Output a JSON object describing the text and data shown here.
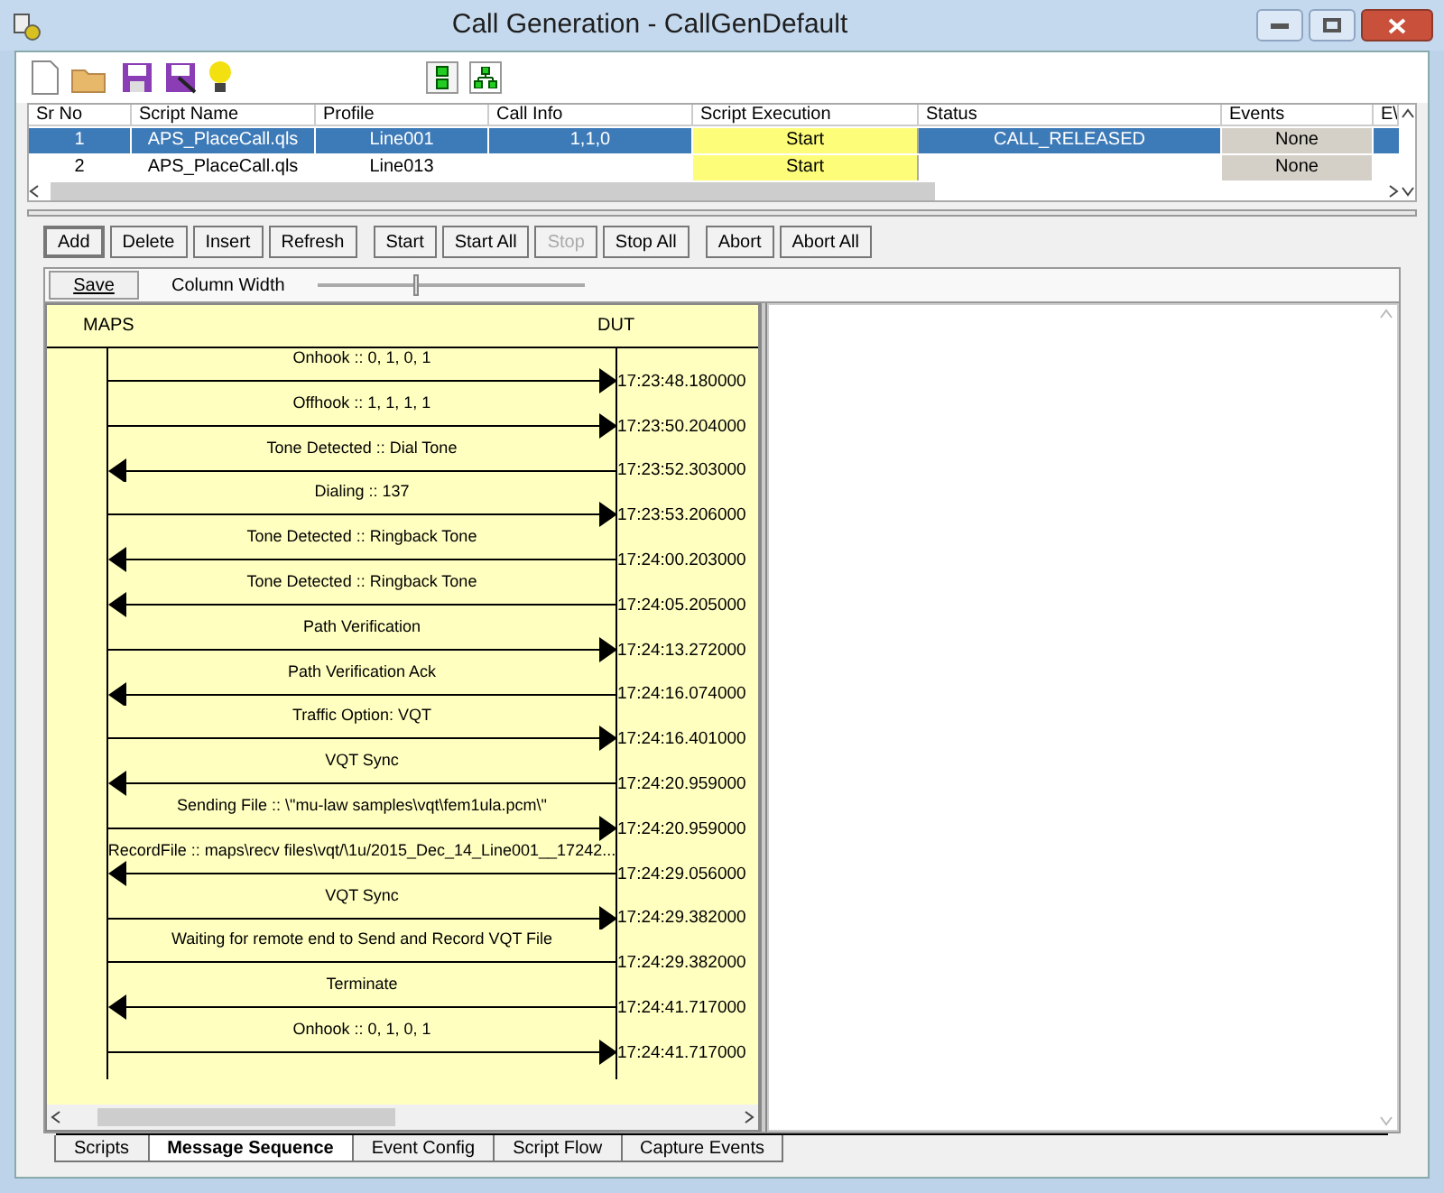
{
  "window": {
    "title": "Call Generation  - CallGenDefault"
  },
  "table": {
    "columns": [
      "Sr No",
      "Script Name",
      "Profile",
      "Call Info",
      "Script Execution",
      "Status",
      "Events",
      "E\\"
    ],
    "rows": [
      {
        "sr_no": "1",
        "script_name": "APS_PlaceCall.qls",
        "profile": "Line001",
        "call_info": "1,1,0",
        "execution": "Start",
        "status": "CALL_RELEASED",
        "events": "None",
        "selected": true
      },
      {
        "sr_no": "2",
        "script_name": "APS_PlaceCall.qls",
        "profile": "Line013",
        "execution": "Start",
        "events": "None",
        "selected": false
      }
    ]
  },
  "buttons": [
    {
      "label": "Add",
      "disabled": false
    },
    {
      "label": "Delete",
      "disabled": false
    },
    {
      "label": "Insert",
      "disabled": false
    },
    {
      "label": "Refresh",
      "disabled": false
    },
    {
      "label": "Start",
      "disabled": false
    },
    {
      "label": "Start All",
      "disabled": false
    },
    {
      "label": "Stop",
      "disabled": true
    },
    {
      "label": "Stop All",
      "disabled": false
    },
    {
      "label": "Abort",
      "disabled": false
    },
    {
      "label": "Abort All",
      "disabled": false
    }
  ],
  "save_button": "Save",
  "column_width": {
    "label": "Column Width",
    "level": 0.37
  },
  "sequence": {
    "left": "MAPS",
    "right": "DUT",
    "messages": [
      {
        "label": "Onhook :: 0, 1, 0, 1",
        "kind": "right",
        "time": "17:23:48.180000"
      },
      {
        "label": "Offhook :: 1, 1, 1, 1",
        "kind": "right",
        "time": "17:23:50.204000"
      },
      {
        "label": "Tone Detected  :: Dial Tone",
        "kind": "left",
        "time": "17:23:52.303000"
      },
      {
        "label": "Dialing :: 137",
        "kind": "right",
        "time": "17:23:53.206000"
      },
      {
        "label": "Tone Detected  :: Ringback Tone",
        "kind": "left",
        "time": "17:24:00.203000"
      },
      {
        "label": "Tone Detected  :: Ringback Tone",
        "kind": "left",
        "time": "17:24:05.205000"
      },
      {
        "label": "Path Verification",
        "kind": "right",
        "time": "17:24:13.272000"
      },
      {
        "label": "Path Verification Ack",
        "kind": "left",
        "time": "17:24:16.074000"
      },
      {
        "label": "Traffic Option: VQT",
        "kind": "right",
        "time": "17:24:16.401000"
      },
      {
        "label": "VQT Sync",
        "kind": "left",
        "time": "17:24:20.959000"
      },
      {
        "label": "Sending File :: \\\"mu-law samples\\vqt\\fem1ula.pcm\\\"",
        "kind": "right",
        "time": "17:24:20.959000"
      },
      {
        "label": "RecordFile  :: maps\\recv files\\vqt/\\1u/2015_Dec_14_Line001__17242...",
        "kind": "left",
        "time": "17:24:29.056000"
      },
      {
        "label": "VQT Sync",
        "kind": "right",
        "time": "17:24:29.382000"
      },
      {
        "label": "Waiting for remote end to Send and Record VQT File",
        "kind": "plain",
        "time": "17:24:29.382000"
      },
      {
        "label": "Terminate",
        "kind": "left",
        "time": "17:24:41.717000"
      },
      {
        "label": "Onhook :: 0, 1, 0, 1",
        "kind": "right",
        "time": "17:24:41.717000"
      }
    ]
  },
  "tabs": [
    {
      "label": "Scripts",
      "selected": false
    },
    {
      "label": "Message Sequence",
      "selected": true
    },
    {
      "label": "Event Config",
      "selected": false
    },
    {
      "label": "Script Flow",
      "selected": false
    },
    {
      "label": "Capture Events",
      "selected": false
    }
  ]
}
